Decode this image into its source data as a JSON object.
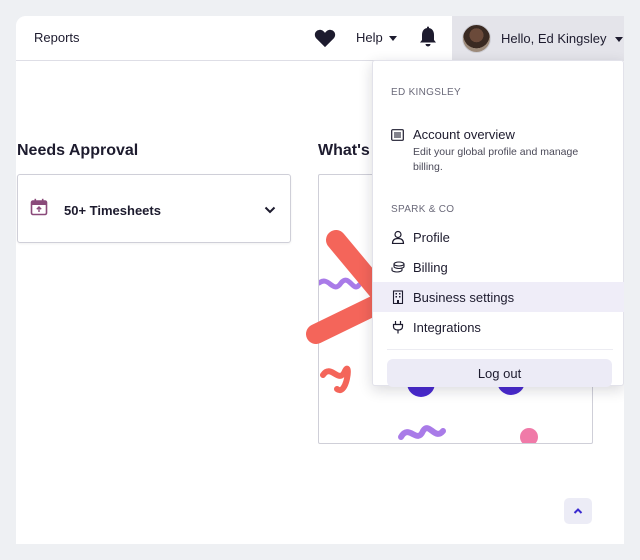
{
  "header": {
    "nav_reports": "Reports",
    "help_label": "Help",
    "user_greeting": "Hello, Ed Kingsley"
  },
  "main": {
    "needs_approval_title": "Needs Approval",
    "timesheets_label": "50+ Timesheets",
    "whats_new_title": "What's"
  },
  "menu": {
    "user_section": "ED KINGSLEY",
    "account_overview_title": "Account overview",
    "account_overview_desc": "Edit your global profile and manage billing.",
    "org_section": "SPARK & CO",
    "items": [
      {
        "label": "Profile",
        "icon": "user-icon"
      },
      {
        "label": "Billing",
        "icon": "coins-icon"
      },
      {
        "label": "Business settings",
        "icon": "building-icon"
      },
      {
        "label": "Integrations",
        "icon": "plug-icon"
      }
    ],
    "active_item": "Business settings",
    "logout_label": "Log out"
  },
  "colors": {
    "accent": "#5b3fd6",
    "highlight_bg": "#efedf8",
    "arrow": "#f4655a",
    "calendar_icon": "#8a4a7a"
  }
}
